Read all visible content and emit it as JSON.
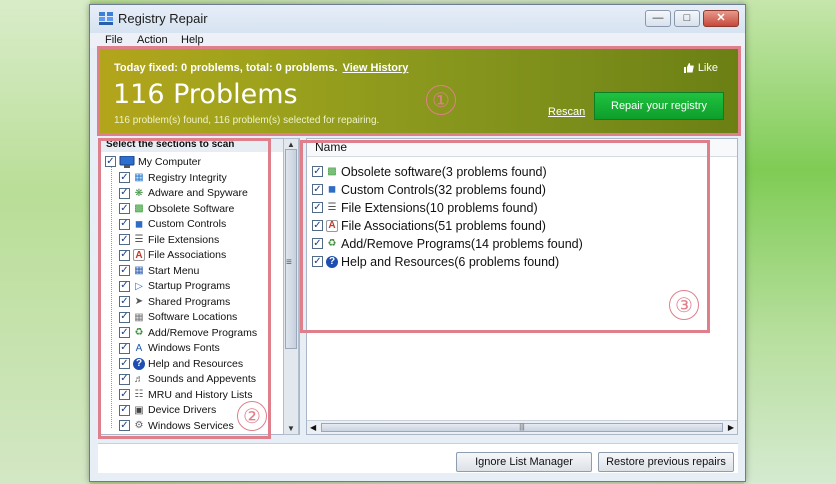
{
  "window": {
    "title": "Registry Repair"
  },
  "menu": {
    "file": "File",
    "action": "Action",
    "help": "Help"
  },
  "banner": {
    "summary": "Today fixed: 0 problems, total: 0 problems.",
    "view_history": "View History",
    "like": "Like",
    "title": "116 Problems",
    "subline": "116 problem(s) found, 116 problem(s) selected for repairing.",
    "rescan": "Rescan",
    "repair_button": "Repair your registry"
  },
  "annotations": {
    "one": "①",
    "two": "②",
    "three": "③"
  },
  "left_panel": {
    "header": "Select the sections to scan",
    "root": "My Computer",
    "items": [
      {
        "label": "Registry Integrity",
        "icon": "grid-icon"
      },
      {
        "label": "Adware and Spyware",
        "icon": "bug-icon"
      },
      {
        "label": "Obsolete Software",
        "icon": "trash-icon"
      },
      {
        "label": "Custom Controls",
        "icon": "blocks-icon"
      },
      {
        "label": "File Extensions",
        "icon": "document-icon"
      },
      {
        "label": "File Associations",
        "icon": "file-a-icon"
      },
      {
        "label": "Start Menu",
        "icon": "start-menu-icon"
      },
      {
        "label": "Startup Programs",
        "icon": "startup-icon"
      },
      {
        "label": "Shared Programs",
        "icon": "shared-icon"
      },
      {
        "label": "Software Locations",
        "icon": "folder-icon"
      },
      {
        "label": "Add/Remove Programs",
        "icon": "add-remove-icon"
      },
      {
        "label": "Windows Fonts",
        "icon": "font-icon"
      },
      {
        "label": "Help and Resources",
        "icon": "help-icon"
      },
      {
        "label": "Sounds and Appevents",
        "icon": "sound-icon"
      },
      {
        "label": "MRU and History Lists",
        "icon": "history-icon"
      },
      {
        "label": "Device Drivers",
        "icon": "driver-icon"
      },
      {
        "label": "Windows Services",
        "icon": "services-icon"
      }
    ]
  },
  "right_panel": {
    "column_name": "Name",
    "results": [
      {
        "label": "Obsolete software(3 problems found)",
        "icon": "trash-icon"
      },
      {
        "label": "Custom Controls(32 problems found)",
        "icon": "blocks-icon"
      },
      {
        "label": "File Extensions(10 problems found)",
        "icon": "document-icon"
      },
      {
        "label": "File Associations(51 problems found)",
        "icon": "file-a-icon"
      },
      {
        "label": "Add/Remove Programs(14 problems found)",
        "icon": "add-remove-icon"
      },
      {
        "label": "Help and Resources(6 problems found)",
        "icon": "help-icon"
      }
    ]
  },
  "bottom": {
    "ignore_list": "Ignore List Manager",
    "restore": "Restore previous repairs"
  },
  "colors": {
    "accent_green": "#12a832",
    "banner_olive": "#8a981d",
    "highlight_pink": "#e07f8c"
  }
}
